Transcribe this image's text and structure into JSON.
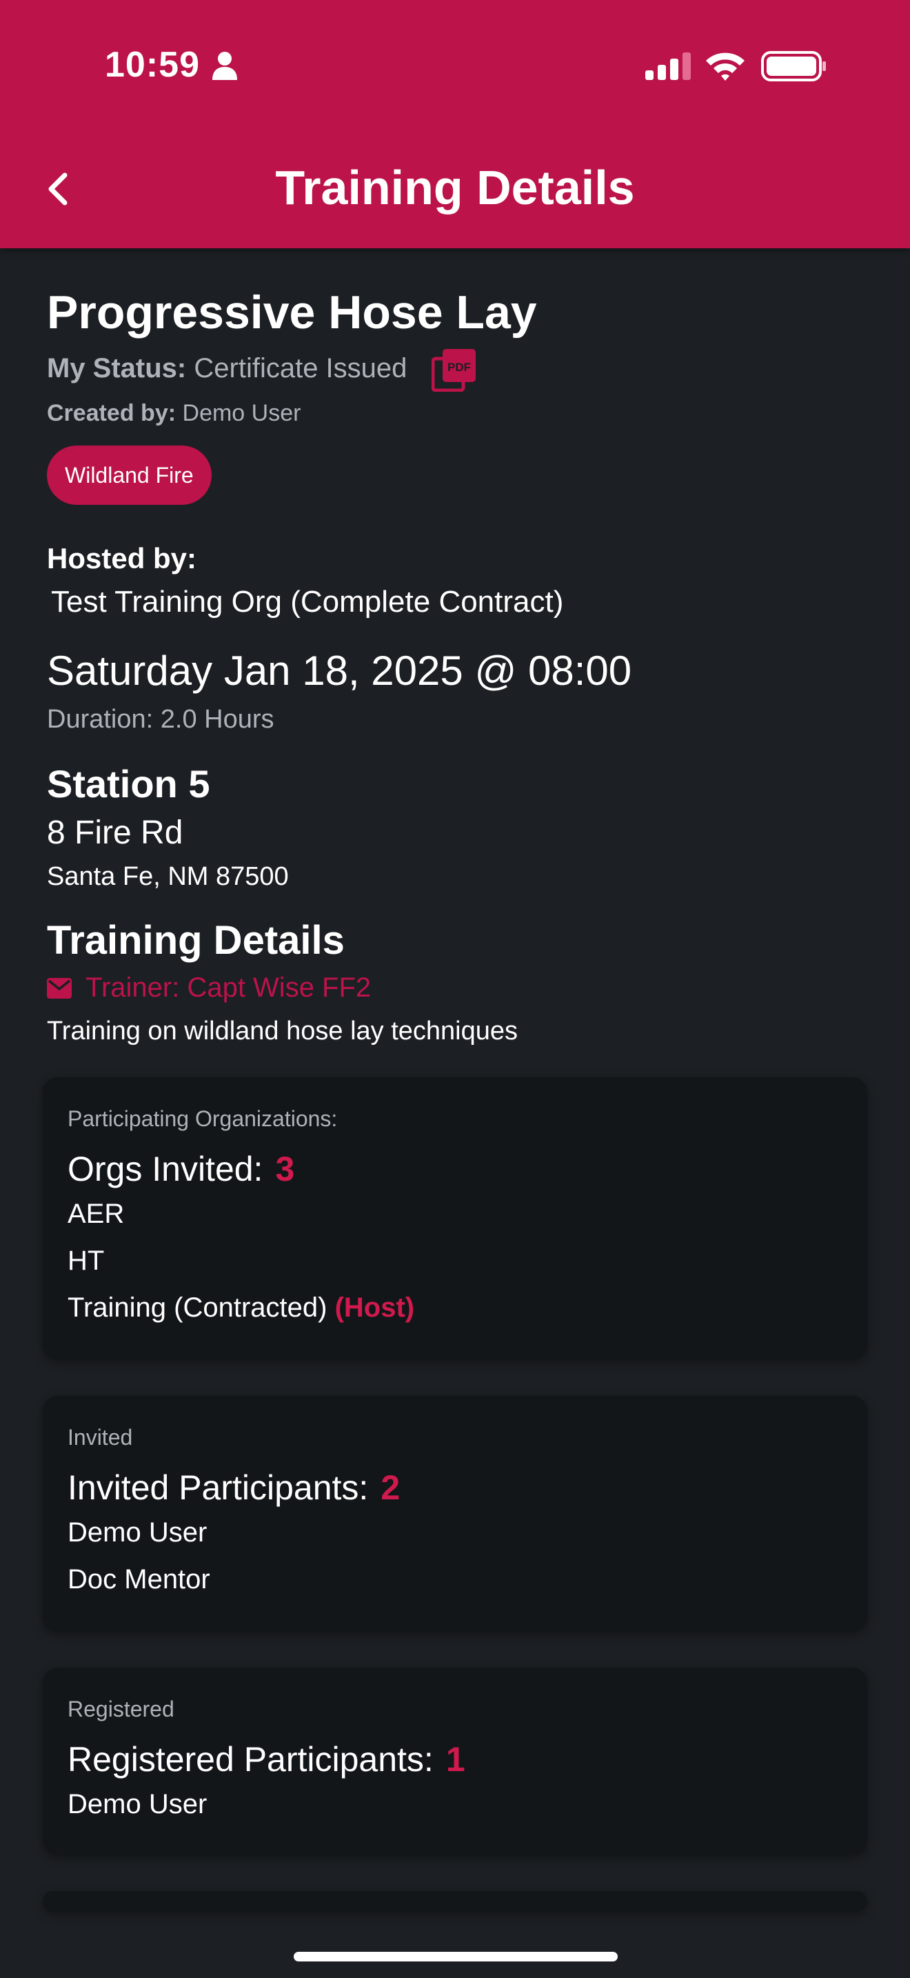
{
  "status_bar": {
    "time": "10:59",
    "icons": [
      "person-icon",
      "signal-icon",
      "wifi-icon",
      "battery-icon"
    ]
  },
  "header": {
    "title": "Training Details",
    "back_icon": "chevron-left-icon"
  },
  "training": {
    "title": "Progressive Hose Lay",
    "status_label": "My Status:",
    "status_value": "Certificate Issued",
    "created_label": "Created by:",
    "created_value": "Demo User",
    "tag": "Wildland Fire",
    "hosted_label": "Hosted by:",
    "hosted_value": "Test Training Org (Complete Contract)",
    "date": "Saturday Jan 18, 2025 @ 08:00",
    "duration": "Duration: 2.0 Hours",
    "station": "Station 5",
    "street": "8 Fire Rd",
    "city": "Santa Fe, NM 87500",
    "details_heading": "Training Details",
    "trainer": "Trainer:  Capt Wise FF2",
    "description": "Training on wildland hose lay techniques"
  },
  "cards": {
    "orgs": {
      "sub": "Participating Organizations:",
      "head": "Orgs Invited:",
      "count": "3",
      "items": [
        "AER",
        "HT",
        "Training (Contracted)"
      ],
      "host_badge": "(Host)"
    },
    "invited": {
      "sub": "Invited",
      "head": "Invited Participants:",
      "count": "2",
      "items": [
        "Demo User",
        "Doc Mentor"
      ]
    },
    "registered": {
      "sub": "Registered",
      "head": "Registered Participants:",
      "count": "1",
      "items": [
        "Demo User"
      ]
    }
  },
  "colors": {
    "accent": "#bb134a",
    "background": "#1c1f23",
    "card": "#131619",
    "muted_text": "#aeb3ba"
  }
}
